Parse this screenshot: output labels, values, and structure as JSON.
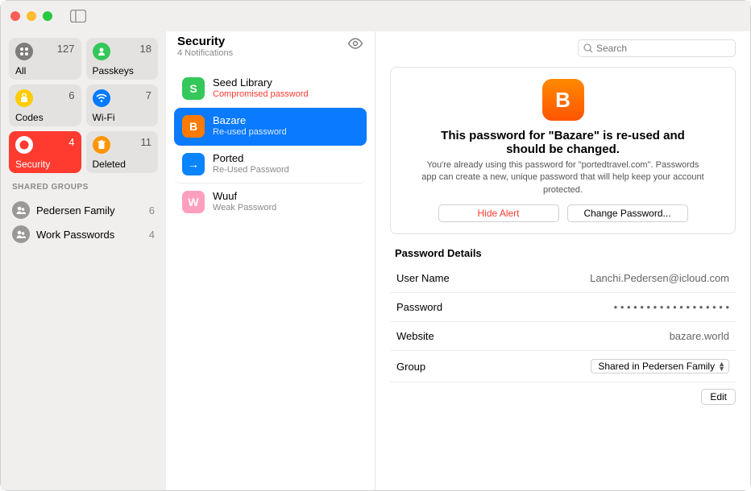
{
  "header": {
    "title": "Security",
    "subtitle": "4 Notifications"
  },
  "search": {
    "placeholder": "Search"
  },
  "sidebar": {
    "categories": [
      {
        "id": "all",
        "label": "All",
        "count": 127,
        "color": "#7f7d7b"
      },
      {
        "id": "passkeys",
        "label": "Passkeys",
        "count": 18,
        "color": "#34c759"
      },
      {
        "id": "codes",
        "label": "Codes",
        "count": 6,
        "color": "#ffcc00"
      },
      {
        "id": "wifi",
        "label": "Wi-Fi",
        "count": 7,
        "color": "#007aff"
      },
      {
        "id": "security",
        "label": "Security",
        "count": 4,
        "color": "#ff3b30",
        "active": true
      },
      {
        "id": "deleted",
        "label": "Deleted",
        "count": 11,
        "color": "#ff9500"
      }
    ],
    "sharedHeader": "SHARED GROUPS",
    "shared": [
      {
        "name": "Pedersen Family",
        "count": 6
      },
      {
        "name": "Work Passwords",
        "count": 4
      }
    ]
  },
  "list": [
    {
      "name": "Seed Library",
      "status": "Compromised password",
      "warn": true,
      "color": "#34c759",
      "initial": "S"
    },
    {
      "name": "Bazare",
      "status": "Re-used password",
      "warn": false,
      "color": "#ff7a00",
      "initial": "B",
      "selected": true
    },
    {
      "name": "Ported",
      "status": "Re-Used Password",
      "warn": false,
      "color": "#0a84ff",
      "initial": "→"
    },
    {
      "name": "Wuuf",
      "status": "Weak Password",
      "warn": false,
      "color": "#ff9fbf",
      "initial": "W"
    }
  ],
  "alert": {
    "title": "This password for \"Bazare\" is re-used and should be changed.",
    "body": "You're already using this password for \"portedtravel.com\". Passwords app can create a new, unique password that will help keep your account protected.",
    "hide": "Hide Alert",
    "change": "Change Password..."
  },
  "details": {
    "heading": "Password Details",
    "rows": {
      "username_k": "User Name",
      "username_v": "Lanchi.Pedersen@icloud.com",
      "password_k": "Password",
      "password_v": "• • • • • • • • • • • • • • • • • •",
      "website_k": "Website",
      "website_v": "bazare.world",
      "group_k": "Group",
      "group_v": "Shared in Pedersen Family"
    },
    "edit": "Edit"
  }
}
